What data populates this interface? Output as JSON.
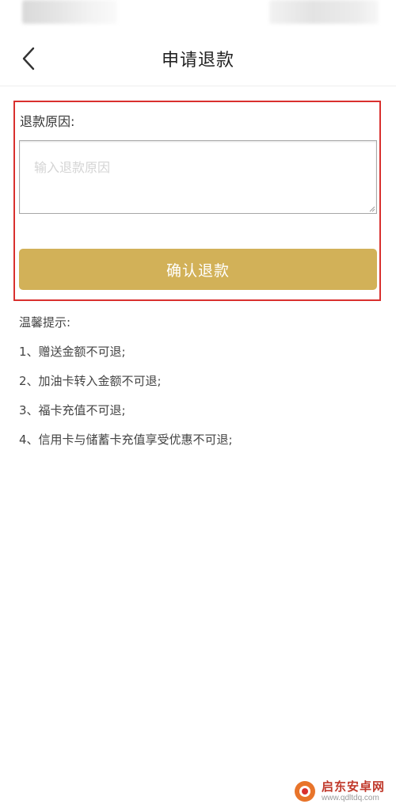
{
  "header": {
    "title": "申请退款",
    "back_icon": "chevron-left-icon"
  },
  "form": {
    "reason_label": "退款原因:",
    "reason_placeholder": "输入退款原因",
    "reason_value": "",
    "confirm_label": "确认退款"
  },
  "tips": {
    "title": "温馨提示:",
    "items": [
      "1、赠送金额不可退;",
      "2、加油卡转入金额不可退;",
      "3、福卡充值不可退;",
      "4、信用卡与储蓄卡充值享受优惠不可退;"
    ]
  },
  "watermark": {
    "text": "启东安卓网",
    "url": "www.qdltdq.com"
  },
  "colors": {
    "accent": "#d2b158",
    "highlight": "#d9302e",
    "text": "#333333",
    "placeholder": "#d4d4d4"
  }
}
